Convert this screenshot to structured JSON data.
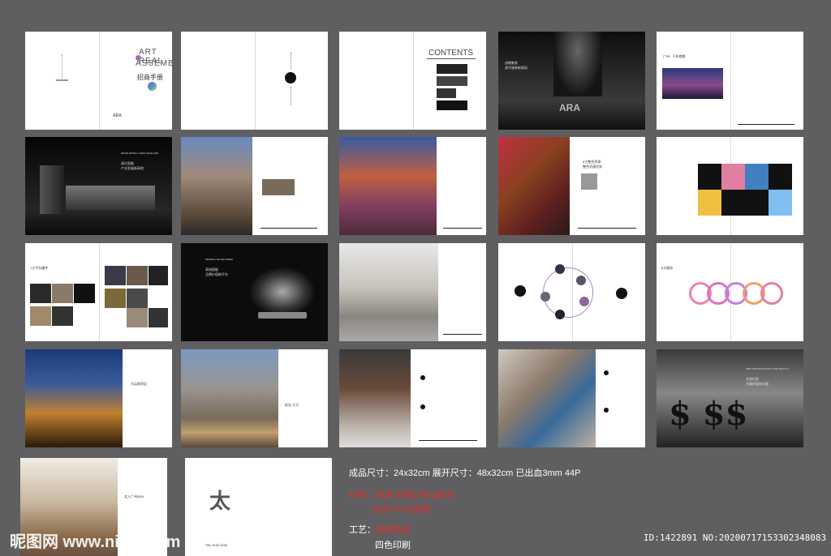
{
  "cover": {
    "title_line1": "ART REAL",
    "title_line2": "ASSEMBLE",
    "subtitle": "招商手册",
    "logo": "ARA"
  },
  "contents_title": "CONTENTS",
  "spreads": {
    "s4_heading": "战略聚焦",
    "s4_sub": "谱写服装新格局",
    "s5_heading": "广州 · 千年商都",
    "s6_kicker": "DEVELOPING A NEW HIGHLAND",
    "s6_heading": "高位智能",
    "s6_sub": "产业发展新高地",
    "s9_heading": "6大整合资源",
    "s9_sub": "整合资源优势",
    "s11_heading": "7大平台硬件",
    "s12_kicker": "SEARCH VALUE ADDED",
    "s12_heading": "高效赋能",
    "s12_sub": "品牌价值新平台",
    "s15_heading": "8大服务",
    "s16_heading": "大运商贸区",
    "s17_heading": "标志 大方",
    "s20_kicker": "NEW OPPORTUNITIES FOR WEALTH",
    "s20_heading": "全球招商",
    "s20_sub": "共赢财富新机遇",
    "s21_heading": "北入广州ARA",
    "s22_phone": "TEL 9122 2222"
  },
  "specs": {
    "size_line": "成品尺寸：24x32cm 展开尺寸：48x32cm 已出血3mm    44P",
    "material_label": "材质：封面 封底/380g珠光",
    "material_inner": "内页/157g雪铜",
    "craft_label": "工艺：",
    "craft_value": "锁线胶装",
    "print_value": "四色印刷"
  },
  "watermark": {
    "site": "昵图网 www.nipic.com",
    "id": "ID:1422891 NO:20200717153302348083"
  },
  "colors": {
    "background": "#5f5f61",
    "red_text": "#e03030",
    "page": "#ffffff",
    "dark_page": "#141414"
  }
}
